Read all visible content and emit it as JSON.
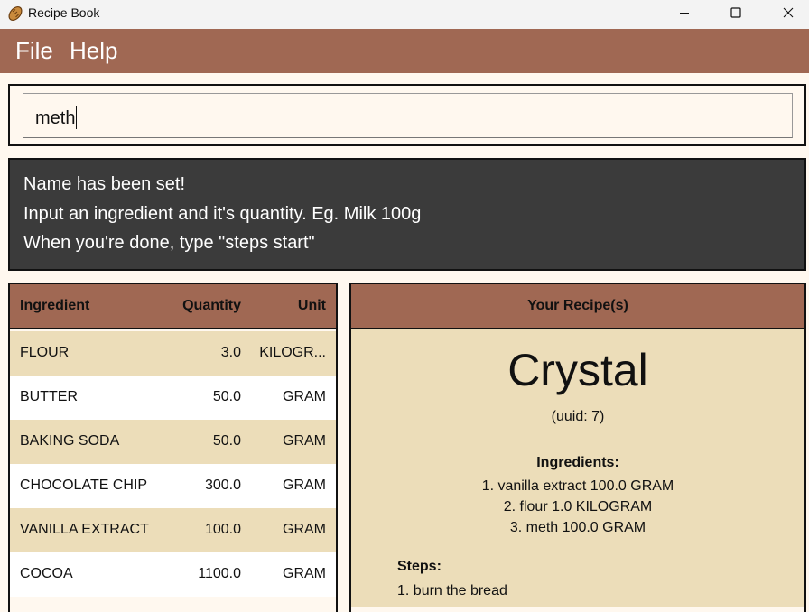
{
  "window": {
    "title": "Recipe Book",
    "icon": "bread-icon"
  },
  "menu": {
    "items": [
      {
        "label": "File"
      },
      {
        "label": "Help"
      }
    ]
  },
  "command_input": {
    "value": "meth"
  },
  "feedback": {
    "lines": [
      "Name has been set!",
      "Input an ingredient and it's quantity. Eg. Milk 100g",
      "When you're done, type \"steps start\""
    ]
  },
  "ingredient_table": {
    "headers": {
      "ingredient": "Ingredient",
      "quantity": "Quantity",
      "unit": "Unit"
    },
    "rows": [
      {
        "name": "FLOUR",
        "quantity": "3.0",
        "unit": "KILOGR..."
      },
      {
        "name": "BUTTER",
        "quantity": "50.0",
        "unit": "GRAM"
      },
      {
        "name": "BAKING SODA",
        "quantity": "50.0",
        "unit": "GRAM"
      },
      {
        "name": "CHOCOLATE CHIP",
        "quantity": "300.0",
        "unit": "GRAM"
      },
      {
        "name": "VANILLA EXTRACT",
        "quantity": "100.0",
        "unit": "GRAM"
      },
      {
        "name": "COCOA",
        "quantity": "1100.0",
        "unit": "GRAM"
      }
    ]
  },
  "recipe_panel": {
    "header": "Your Recipe(s)",
    "name": "Crystal",
    "uuid": "(uuid: 7)",
    "ingredients_title": "Ingredients:",
    "ingredients": [
      "1. vanilla extract 100.0 GRAM",
      "2. flour 1.0 KILOGRAM",
      "3. meth 100.0 GRAM"
    ],
    "steps_title": "Steps:",
    "steps": [
      "1. burn the bread"
    ]
  },
  "colors": {
    "accent": "#a06853",
    "row_alt": "#ecddb9",
    "background": "#fff8ef",
    "feedback_bg": "#3b3b3b"
  }
}
